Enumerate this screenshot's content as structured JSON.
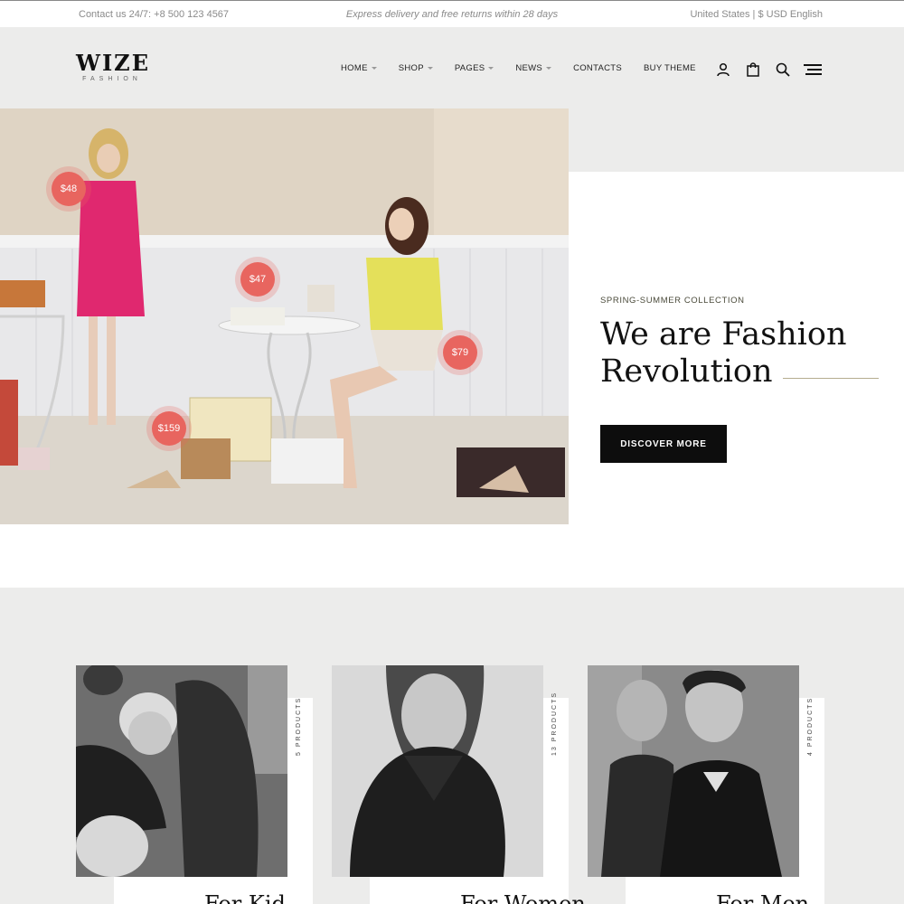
{
  "topbar": {
    "contact": "Contact us 24/7: +8 500 123 4567",
    "promo": "Express delivery and free returns within 28 days",
    "locale": "United States | $ USD English"
  },
  "logo": {
    "main": "WIZE",
    "sub": "FASHION"
  },
  "nav": [
    {
      "label": "HOME",
      "dropdown": true
    },
    {
      "label": "SHOP",
      "dropdown": true
    },
    {
      "label": "PAGES",
      "dropdown": true
    },
    {
      "label": "NEWS",
      "dropdown": true
    },
    {
      "label": "CONTACTS",
      "dropdown": false
    },
    {
      "label": "BUY THEME",
      "dropdown": false
    }
  ],
  "header_icons": [
    "user-icon",
    "shopping-bag-icon",
    "search-icon",
    "menu-icon"
  ],
  "hero": {
    "kicker": "SPRING-SUMMER COLLECTION",
    "title_line1": "We are Fashion",
    "title_line2": "Revolution",
    "button": "DISCOVER MORE",
    "prices": [
      "$48",
      "$47",
      "$79",
      "$159"
    ]
  },
  "categories": [
    {
      "title": "For Kid",
      "count": "5 PRODUCTS"
    },
    {
      "title": "For Women",
      "count": "13 PRODUCTS"
    },
    {
      "title": "For Men",
      "count": "4 PRODUCTS"
    }
  ],
  "colors": {
    "accent_price": "#e8655f",
    "button_bg": "#0d0d0d",
    "page_bg": "#ececeb"
  }
}
